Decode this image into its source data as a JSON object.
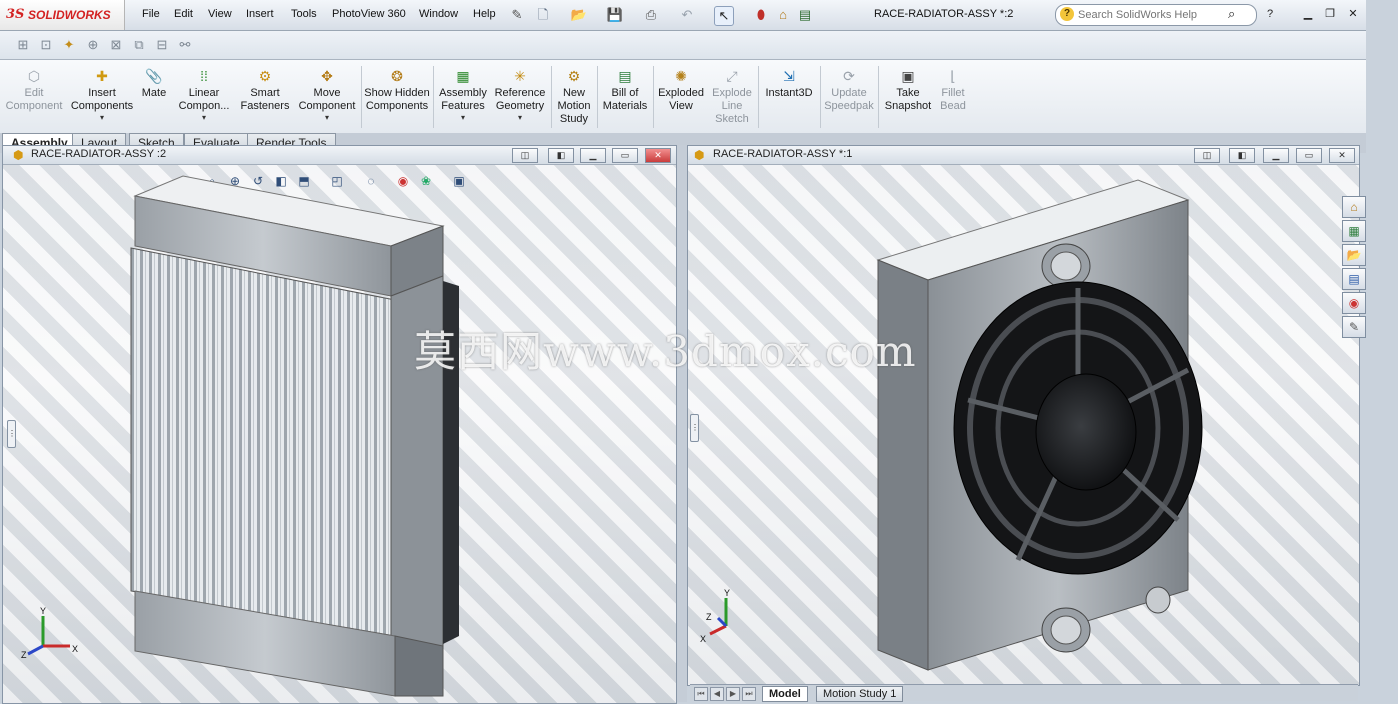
{
  "app": {
    "brand_mark": "3S",
    "brand_name": "SOLIDWORKS"
  },
  "menu": [
    "File",
    "Edit",
    "View",
    "Insert",
    "Tools",
    "PhotoView 360",
    "Window",
    "Help"
  ],
  "document_title": "RACE-RADIATOR-ASSY *:2",
  "search": {
    "placeholder": "Search SolidWorks Help"
  },
  "command_manager": [
    {
      "label": "Edit Component",
      "icon": "edit-component-icon",
      "enabled": false
    },
    {
      "label": "Insert Components",
      "icon": "insert-components-icon",
      "enabled": true,
      "dropdown": true
    },
    {
      "label": "Mate",
      "icon": "mate-icon",
      "enabled": true
    },
    {
      "label": "Linear Compon...",
      "icon": "linear-pattern-icon",
      "enabled": true,
      "dropdown": true
    },
    {
      "label": "Smart Fasteners",
      "icon": "smart-fasteners-icon",
      "enabled": true
    },
    {
      "label": "Move Component",
      "icon": "move-component-icon",
      "enabled": true,
      "dropdown": true
    },
    {
      "label": "Show Hidden Components",
      "icon": "show-hidden-icon",
      "enabled": true
    },
    {
      "label": "Assembly Features",
      "icon": "assembly-features-icon",
      "enabled": true,
      "dropdown": true
    },
    {
      "label": "Reference Geometry",
      "icon": "reference-geometry-icon",
      "enabled": true,
      "dropdown": true
    },
    {
      "label": "New Motion Study",
      "icon": "motion-study-icon",
      "enabled": true
    },
    {
      "label": "Bill of Materials",
      "icon": "bill-of-materials-icon",
      "enabled": true
    },
    {
      "label": "Exploded View",
      "icon": "exploded-view-icon",
      "enabled": true
    },
    {
      "label": "Explode Line Sketch",
      "icon": "explode-line-icon",
      "enabled": false
    },
    {
      "label": "Instant3D",
      "icon": "instant3d-icon",
      "enabled": true
    },
    {
      "label": "Update Speedpak",
      "icon": "speedpak-icon",
      "enabled": false
    },
    {
      "label": "Take Snapshot",
      "icon": "snapshot-icon",
      "enabled": true
    },
    {
      "label": "Fillet Bead",
      "icon": "fillet-bead-icon",
      "enabled": false
    }
  ],
  "tabs": [
    "Assembly",
    "Layout",
    "Sketch",
    "Evaluate",
    "Render Tools"
  ],
  "active_tab": "Assembly",
  "viewports": {
    "left": {
      "title": "RACE-RADIATOR-ASSY :2"
    },
    "right": {
      "title": "RACE-RADIATOR-ASSY *:1"
    }
  },
  "triad": {
    "x": "X",
    "y": "Y",
    "z": "Z"
  },
  "overlay_watermark": "莫西网www.3dmox.com",
  "bottom_tabs": [
    "Model",
    "Motion Study 1"
  ],
  "colors": {
    "brand_red": "#d32222",
    "viewport_border": "#8795a6"
  }
}
